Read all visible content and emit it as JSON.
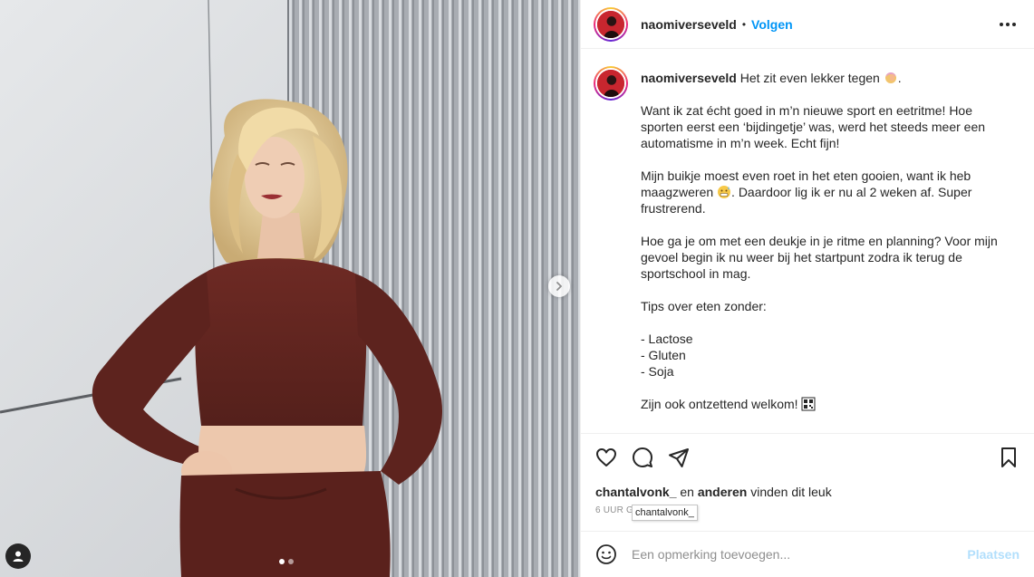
{
  "post": {
    "username": "naomiverseveld",
    "separator": "•",
    "follow_label": "Volgen",
    "more_icon": "more-horizontal-icon"
  },
  "caption": {
    "username": "naomiverseveld",
    "intro": "Het zit even lekker tegen",
    "intro_end": ".",
    "p1": "Want ik zat écht goed in m’n nieuwe sport en eetritme! Hoe sporten eerst een ‘bijdingetje’ was, werd het steeds meer een automatisme in m’n week. Echt fijn!",
    "p2_a": "Mijn buikje moest even roet in het eten gooien, want ik heb maagzweren",
    "p2_b": ". Daardoor lig ik er nu al 2 weken af. Super frustrerend.",
    "p3": "Hoe ga je om met een deukje in je ritme en planning? Voor mijn gevoel begin ik nu weer bij het startpunt zodra ik terug de sportschool in mag.",
    "p4": "Tips over eten zonder:",
    "list": [
      "- Lactose",
      "- Gluten",
      "- Soja"
    ],
    "p5": "Zijn ook ontzettend welkom!"
  },
  "likes": {
    "first_user": "chantalvonk_",
    "and": "en",
    "others": "anderen",
    "suffix": "vinden dit leuk"
  },
  "timestamp": "6 UUR GELEDEN",
  "tooltip": "chantalvonk_",
  "comment": {
    "placeholder": "Een opmerking toevoegen...",
    "post_label": "Plaatsen"
  },
  "carousel": {
    "total_slides": 2,
    "active_slide": 1
  },
  "colors": {
    "accent": "#0095f6",
    "post_disabled": "#b2dffc",
    "muted": "#8e8e8e",
    "text": "#262626"
  }
}
